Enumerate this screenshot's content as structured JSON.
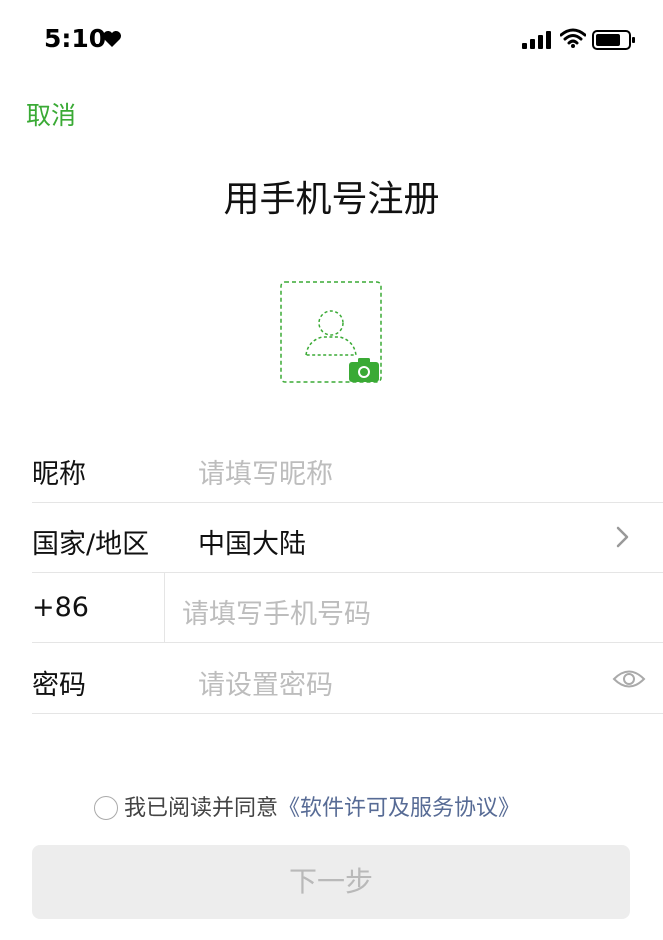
{
  "status": {
    "time": "5:10"
  },
  "nav": {
    "cancel": "取消"
  },
  "page": {
    "title": "用手机号注册"
  },
  "form": {
    "nickname": {
      "label": "昵称",
      "placeholder": "请填写昵称"
    },
    "region": {
      "label": "国家/地区",
      "value": "中国大陆"
    },
    "phone": {
      "code": "+86",
      "placeholder": "请填写手机号码"
    },
    "password": {
      "label": "密码",
      "placeholder": "请设置密码"
    }
  },
  "agreement": {
    "text": "我已阅读并同意",
    "link": "《软件许可及服务协议》"
  },
  "next_button": "下一步",
  "colors": {
    "accent": "#3aaa35",
    "link": "#576b95"
  }
}
